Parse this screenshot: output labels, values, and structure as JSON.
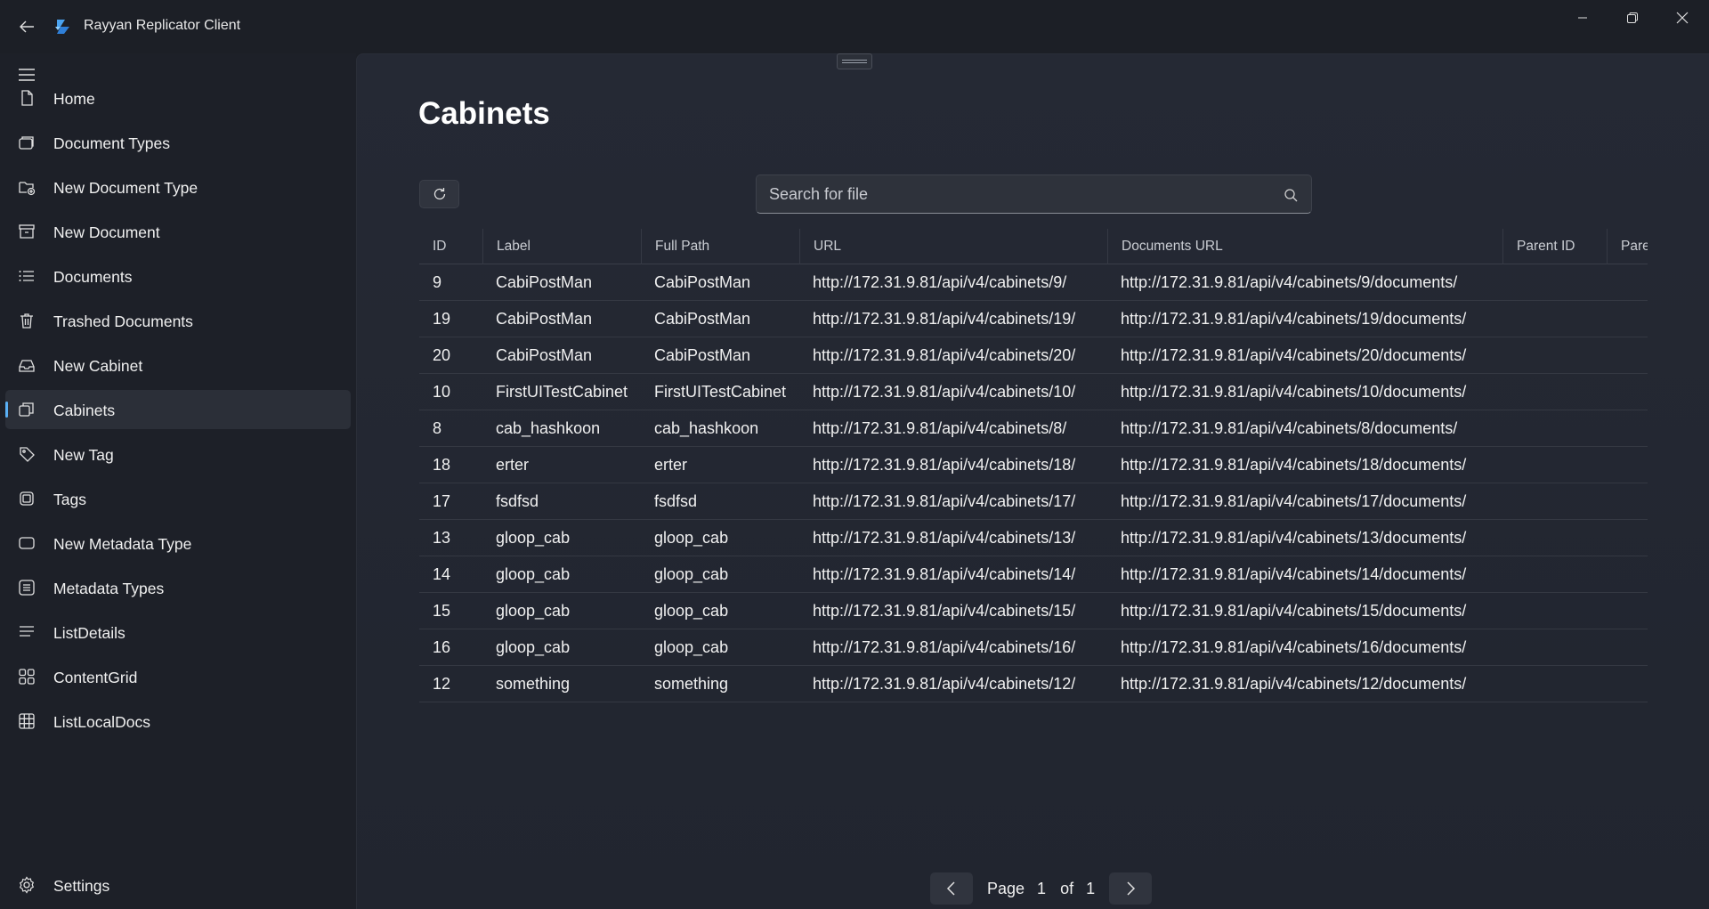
{
  "app": {
    "title": "Rayyan Replicator Client"
  },
  "sidebar": {
    "items": [
      {
        "label": "Home",
        "icon": "document-icon"
      },
      {
        "label": "Document Types",
        "icon": "stacked-cards-icon"
      },
      {
        "label": "New Document Type",
        "icon": "folder-add-icon"
      },
      {
        "label": "New Document",
        "icon": "archive-icon"
      },
      {
        "label": "Documents",
        "icon": "bulleted-list-icon"
      },
      {
        "label": "Trashed Documents",
        "icon": "trash-icon"
      },
      {
        "label": "New Cabinet",
        "icon": "inbox-icon"
      },
      {
        "label": "Cabinets",
        "icon": "copy-icon"
      },
      {
        "label": "New Tag",
        "icon": "tag-icon"
      },
      {
        "label": "Tags",
        "icon": "square-icon"
      },
      {
        "label": "New Metadata Type",
        "icon": "rounded-rect-icon"
      },
      {
        "label": "Metadata Types",
        "icon": "keyboard-icon"
      },
      {
        "label": "ListDetails",
        "icon": "list-lines-icon"
      },
      {
        "label": "ContentGrid",
        "icon": "grid-icon"
      },
      {
        "label": "ListLocalDocs",
        "icon": "table-icon"
      }
    ],
    "active_index": 7,
    "settings_label": "Settings"
  },
  "main": {
    "title": "Cabinets",
    "search": {
      "placeholder": "Search for file",
      "value": ""
    },
    "table": {
      "columns": [
        "ID",
        "Label",
        "Full Path",
        "URL",
        "Documents URL",
        "Parent ID",
        "Pare"
      ],
      "rows": [
        [
          "9",
          "CabiPostMan",
          "CabiPostMan",
          "http://172.31.9.81/api/v4/cabinets/9/",
          "http://172.31.9.81/api/v4/cabinets/9/documents/",
          "",
          ""
        ],
        [
          "19",
          "CabiPostMan",
          "CabiPostMan",
          "http://172.31.9.81/api/v4/cabinets/19/",
          "http://172.31.9.81/api/v4/cabinets/19/documents/",
          "",
          ""
        ],
        [
          "20",
          "CabiPostMan",
          "CabiPostMan",
          "http://172.31.9.81/api/v4/cabinets/20/",
          "http://172.31.9.81/api/v4/cabinets/20/documents/",
          "",
          ""
        ],
        [
          "10",
          "FirstUITestCabinet",
          "FirstUITestCabinet",
          "http://172.31.9.81/api/v4/cabinets/10/",
          "http://172.31.9.81/api/v4/cabinets/10/documents/",
          "",
          ""
        ],
        [
          "8",
          "cab_hashkoon",
          "cab_hashkoon",
          "http://172.31.9.81/api/v4/cabinets/8/",
          "http://172.31.9.81/api/v4/cabinets/8/documents/",
          "",
          ""
        ],
        [
          "18",
          "erter",
          "erter",
          "http://172.31.9.81/api/v4/cabinets/18/",
          "http://172.31.9.81/api/v4/cabinets/18/documents/",
          "",
          ""
        ],
        [
          "17",
          "fsdfsd",
          "fsdfsd",
          "http://172.31.9.81/api/v4/cabinets/17/",
          "http://172.31.9.81/api/v4/cabinets/17/documents/",
          "",
          ""
        ],
        [
          "13",
          "gloop_cab",
          "gloop_cab",
          "http://172.31.9.81/api/v4/cabinets/13/",
          "http://172.31.9.81/api/v4/cabinets/13/documents/",
          "",
          ""
        ],
        [
          "14",
          "gloop_cab",
          "gloop_cab",
          "http://172.31.9.81/api/v4/cabinets/14/",
          "http://172.31.9.81/api/v4/cabinets/14/documents/",
          "",
          ""
        ],
        [
          "15",
          "gloop_cab",
          "gloop_cab",
          "http://172.31.9.81/api/v4/cabinets/15/",
          "http://172.31.9.81/api/v4/cabinets/15/documents/",
          "",
          ""
        ],
        [
          "16",
          "gloop_cab",
          "gloop_cab",
          "http://172.31.9.81/api/v4/cabinets/16/",
          "http://172.31.9.81/api/v4/cabinets/16/documents/",
          "",
          ""
        ],
        [
          "12",
          "something",
          "something",
          "http://172.31.9.81/api/v4/cabinets/12/",
          "http://172.31.9.81/api/v4/cabinets/12/documents/",
          "",
          ""
        ]
      ]
    },
    "pagination": {
      "page_label": "Page",
      "current_page": "1",
      "of_label": "of",
      "total_pages": "1"
    }
  },
  "colors": {
    "accent": "#5ab0f5",
    "background": "#1c1f26",
    "content_background": "#252934"
  }
}
